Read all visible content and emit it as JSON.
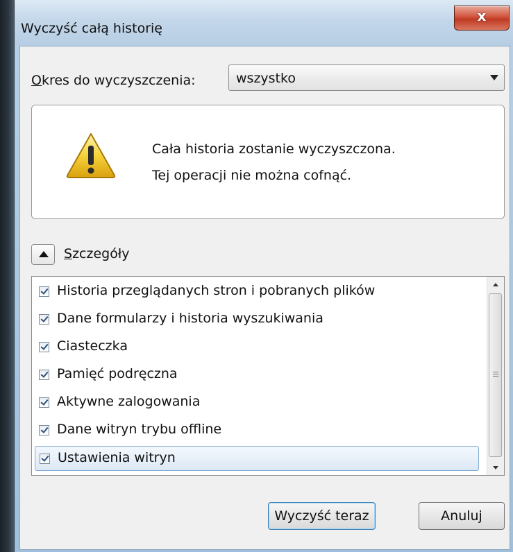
{
  "window": {
    "title": "Wyczyść całą historię",
    "close_label": "x"
  },
  "period": {
    "label_underlined": "O",
    "label_rest": "kres do wyczyszczenia:",
    "selected_value": "wszystko"
  },
  "warning": {
    "icon": "warning-triangle-icon",
    "line1": "Cała historia zostanie wyczyszczona.",
    "line2": "Tej operacji nie można cofnąć."
  },
  "details": {
    "toggle_icon": "chevron-up-icon",
    "label_underlined": "S",
    "label_rest": "zczegóły"
  },
  "items": [
    {
      "label": "Historia przeglądanych stron i pobranych plików",
      "checked": true
    },
    {
      "label": "Dane formularzy i historia wyszukiwania",
      "checked": true
    },
    {
      "label": "Ciasteczka",
      "checked": true
    },
    {
      "label": "Pamięć podręczna",
      "checked": true
    },
    {
      "label": "Aktywne zalogowania",
      "checked": true
    },
    {
      "label": "Dane witryn trybu offline",
      "checked": true
    },
    {
      "label": "Ustawienia witryn",
      "checked": true,
      "selected": true
    }
  ],
  "buttons": {
    "clear": "Wyczyść teraz",
    "cancel": "Anuluj"
  }
}
